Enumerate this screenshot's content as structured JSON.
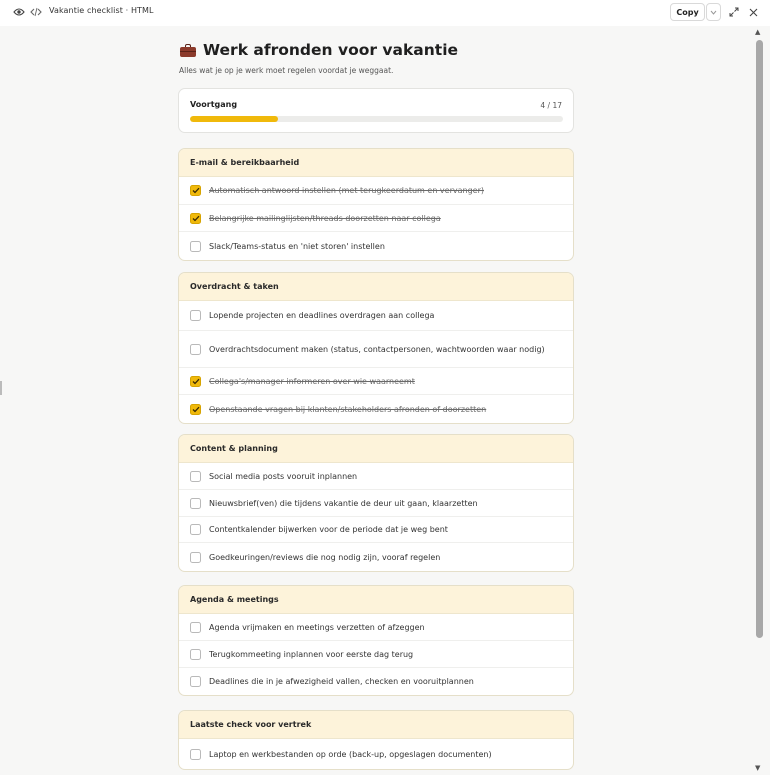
{
  "window": {
    "title": "Vakantie checklist · HTML",
    "copy_label": "Copy"
  },
  "header": {
    "title": "Werk afronden voor vakantie",
    "subtitle": "Alles wat je op je werk moet regelen voordat je weggaat."
  },
  "progress": {
    "label": "Voortgang",
    "count": "4 / 17",
    "done": 4,
    "total": 17
  },
  "colors": {
    "accent": "#f0b90b",
    "section_header_bg": "#fdf3da"
  },
  "sections": [
    {
      "title": "E-mail & bereikbaarheid",
      "items": [
        {
          "text": "Automatisch antwoord instellen (met terugkeerdatum en vervanger)",
          "checked": true
        },
        {
          "text": "Belangrijke mailinglijsten/threads doorzetten naar collega",
          "checked": true
        },
        {
          "text": "Slack/Teams-status en 'niet storen' instellen",
          "checked": false
        }
      ]
    },
    {
      "title": "Overdracht & taken",
      "items": [
        {
          "text": "Lopende projecten en deadlines overdragen aan collega",
          "checked": false
        },
        {
          "text": "Overdrachtsdocument maken (status, contactpersonen, wachtwoorden waar nodig)",
          "checked": false
        },
        {
          "text": "Collega's/manager informeren over wie waarneemt",
          "checked": true
        },
        {
          "text": "Openstaande vragen bij klanten/stakeholders afronden of doorzetten",
          "checked": true
        }
      ]
    },
    {
      "title": "Content & planning",
      "items": [
        {
          "text": "Social media posts vooruit inplannen",
          "checked": false
        },
        {
          "text": "Nieuwsbrief(ven) die tijdens vakantie de deur uit gaan, klaarzetten",
          "checked": false
        },
        {
          "text": "Contentkalender bijwerken voor de periode dat je weg bent",
          "checked": false
        },
        {
          "text": "Goedkeuringen/reviews die nog nodig zijn, vooraf regelen",
          "checked": false
        }
      ]
    },
    {
      "title": "Agenda & meetings",
      "items": [
        {
          "text": "Agenda vrijmaken en meetings verzetten of afzeggen",
          "checked": false
        },
        {
          "text": "Terugkommeeting inplannen voor eerste dag terug",
          "checked": false
        },
        {
          "text": "Deadlines die in je afwezigheid vallen, checken en vooruitplannen",
          "checked": false
        }
      ]
    },
    {
      "title": "Laatste check voor vertrek",
      "items": [
        {
          "text": "Laptop en werkbestanden op orde (back-up, opgeslagen documenten)",
          "checked": false
        }
      ]
    }
  ]
}
